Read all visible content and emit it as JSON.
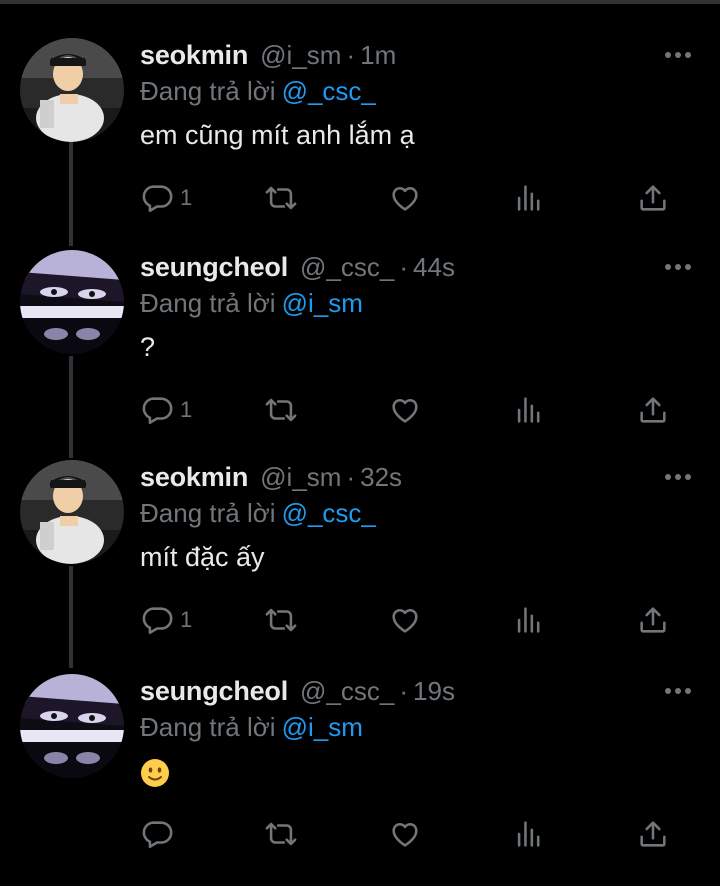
{
  "tweets": [
    {
      "author_name": "seokmin",
      "author_handle": "@i_sm",
      "separator": "·",
      "time": "1m",
      "reply_prefix": "Đang trả lời",
      "reply_mention": "@_csc_",
      "body": "em cũng mít anh lắm ạ",
      "reply_count": "1",
      "avatar_icon": "seokmin-avatar"
    },
    {
      "author_name": "seungcheol",
      "author_handle": "@_csc_",
      "separator": "·",
      "time": "44s",
      "reply_prefix": "Đang trả lời",
      "reply_mention": "@i_sm",
      "body": "?",
      "reply_count": "1",
      "avatar_icon": "seungcheol-avatar"
    },
    {
      "author_name": "seokmin",
      "author_handle": "@i_sm",
      "separator": "·",
      "time": "32s",
      "reply_prefix": "Đang trả lời",
      "reply_mention": "@_csc_",
      "body": "mít đặc ấy",
      "reply_count": "1",
      "avatar_icon": "seokmin-avatar"
    },
    {
      "author_name": "seungcheol",
      "author_handle": "@_csc_",
      "separator": "·",
      "time": "19s",
      "reply_prefix": "Đang trả lời",
      "reply_mention": "@i_sm",
      "body": "",
      "body_emoji": "slightly-smiling-face-emoji",
      "reply_count": "",
      "avatar_icon": "seungcheol-avatar"
    }
  ],
  "icons": {
    "reply": "reply-icon",
    "retweet": "retweet-icon",
    "like": "heart-icon",
    "views": "views-icon",
    "share": "share-icon",
    "more": "more-icon"
  },
  "colors": {
    "background": "#000000",
    "text": "#e7e9ea",
    "secondary": "#71767b",
    "mention": "#1d9bf0",
    "thread_line": "#2f3336"
  }
}
